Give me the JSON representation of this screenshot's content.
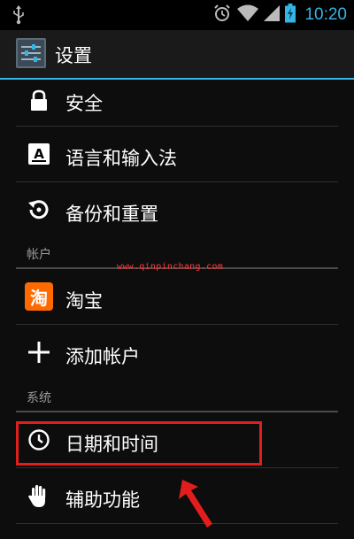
{
  "status_bar": {
    "time": "10:20",
    "icons": [
      "usb-icon",
      "alarm-icon",
      "wifi-icon",
      "signal-icon",
      "battery-icon"
    ]
  },
  "action_bar": {
    "title": "设置",
    "icon": "settings-app-icon"
  },
  "rows": [
    {
      "label": "安全",
      "icon": "lock-icon"
    },
    {
      "label": "语言和输入法",
      "icon": "keyboard-icon"
    },
    {
      "label": "备份和重置",
      "icon": "restore-icon"
    }
  ],
  "sections": {
    "accounts": "帐户",
    "system": "系统"
  },
  "account_rows": [
    {
      "label": "淘宝",
      "icon": "taobao-icon",
      "icon_text": "淘"
    },
    {
      "label": "添加帐户",
      "icon": "plus-icon"
    }
  ],
  "system_rows": [
    {
      "label": "日期和时间",
      "icon": "clock-icon"
    },
    {
      "label": "辅助功能",
      "icon": "hand-icon"
    }
  ],
  "watermark": "www.qinpinchang.com",
  "colors": {
    "accent": "#33b5e5",
    "highlight": "#e21d1d",
    "taobao": "#ff6a00"
  }
}
